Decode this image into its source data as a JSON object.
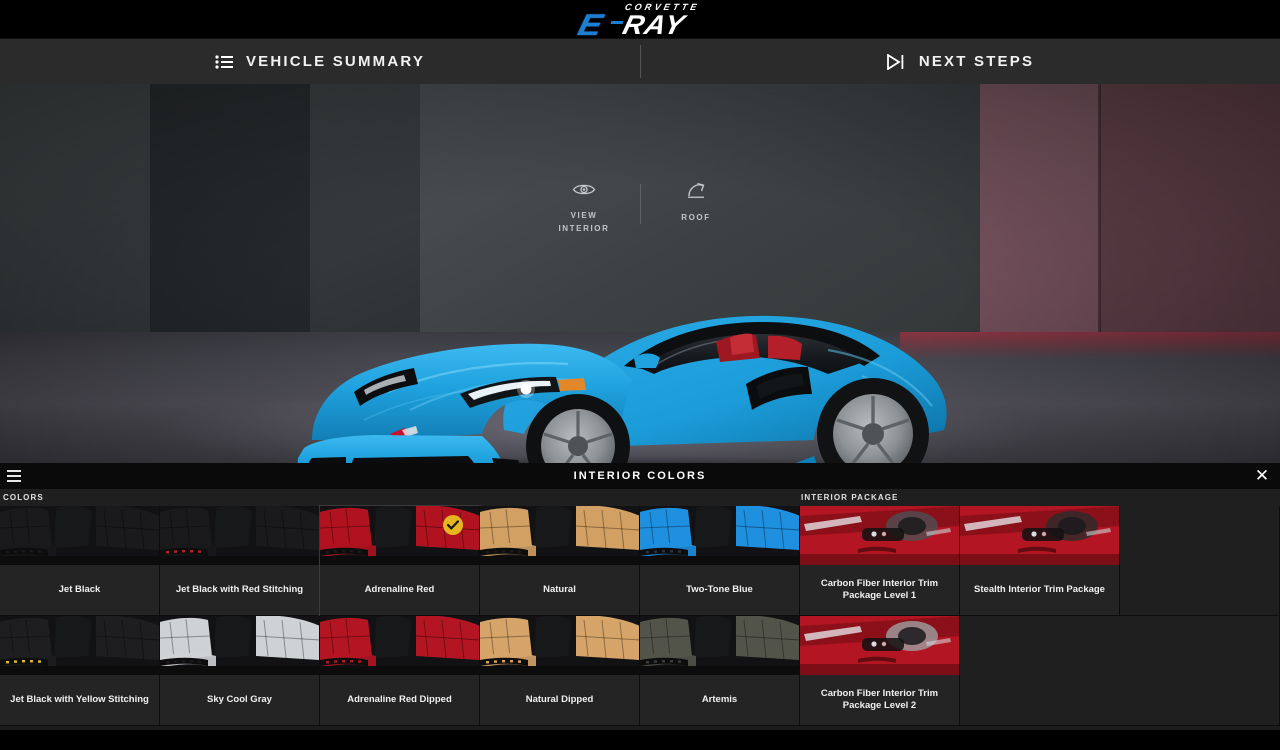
{
  "brand": {
    "name_top": "CORVETTE",
    "name_main": "RAY",
    "mark": "E"
  },
  "top_nav": [
    {
      "id": "vehicle-summary",
      "label": "VEHICLE SUMMARY",
      "icon": "list-icon"
    },
    {
      "id": "next-steps",
      "label": "NEXT STEPS",
      "icon": "play-next-icon"
    }
  ],
  "stage": {
    "controls": [
      {
        "id": "view-interior",
        "line1": "VIEW",
        "line2": "INTERIOR",
        "icon": "eye-icon"
      },
      {
        "id": "roof",
        "line1": "ROOF",
        "line2": "",
        "icon": "roof-arrow-icon"
      }
    ],
    "vehicle": {
      "body_color": "#1fa2de",
      "interior_color": "#b3202a",
      "wheel_color": "#8e9296"
    }
  },
  "panel": {
    "title": "INTERIOR COLORS",
    "menu_icon": "hamburger-icon",
    "close_icon": "close-icon",
    "sections": [
      {
        "id": "colors",
        "label": "COLORS"
      },
      {
        "id": "interior-package",
        "label": "INTERIOR PACKAGE"
      }
    ],
    "selected_swatch": "Adrenaline Red",
    "check_color": "#e7b51f",
    "rows": [
      [
        {
          "id": "jet-black",
          "label": "Jet Black",
          "group": "colors",
          "swatch": "#1a1a1c",
          "accent": "#1a1a1c",
          "selected": false
        },
        {
          "id": "jet-black-red-stitching",
          "label": "Jet Black with Red Stitching",
          "group": "colors",
          "swatch": "#1a1a1c",
          "accent": "#b3202a",
          "selected": false
        },
        {
          "id": "adrenaline-red",
          "label": "Adrenaline Red",
          "group": "colors",
          "swatch": "#b0121f",
          "accent": "#1a1a1c",
          "selected": true
        },
        {
          "id": "natural",
          "label": "Natural",
          "group": "colors",
          "swatch": "#d2a063",
          "accent": "#1a1a1c",
          "selected": false
        },
        {
          "id": "two-tone-blue",
          "label": "Two-Tone Blue",
          "group": "colors",
          "swatch": "#1f8fe0",
          "accent": "#2b3140",
          "selected": false
        },
        {
          "id": "carbon-fiber-level-1",
          "label": "Carbon Fiber Interior Trim Package Level 1",
          "group": "package",
          "swatch": "#b41522",
          "accent": "#4c4f52",
          "selected": false
        },
        {
          "id": "stealth-trim",
          "label": "Stealth Interior Trim Package",
          "group": "package",
          "swatch": "#b41522",
          "accent": "#2a2a2c",
          "selected": false
        }
      ],
      [
        {
          "id": "jet-black-yellow-stitching",
          "label": "Jet Black with Yellow Stitching",
          "group": "colors",
          "swatch": "#1e1e20",
          "accent": "#d8b93a",
          "selected": false
        },
        {
          "id": "sky-cool-gray",
          "label": "Sky Cool Gray",
          "group": "colors",
          "swatch": "#cfd2d4",
          "accent": "#1a1a1c",
          "selected": false
        },
        {
          "id": "adrenaline-red-dipped",
          "label": "Adrenaline Red Dipped",
          "group": "colors",
          "swatch": "#b41522",
          "accent": "#b41522",
          "selected": false
        },
        {
          "id": "natural-dipped",
          "label": "Natural Dipped",
          "group": "colors",
          "swatch": "#d6a468",
          "accent": "#d6a468",
          "selected": false
        },
        {
          "id": "artemis",
          "label": "Artemis",
          "group": "colors",
          "swatch": "#52544a",
          "accent": "#3b3d36",
          "selected": false
        },
        {
          "id": "carbon-fiber-level-2",
          "label": "Carbon Fiber Interior Trim Package Level 2",
          "group": "package",
          "swatch": "#b41522",
          "accent": "#9da0a3",
          "selected": false
        }
      ]
    ]
  }
}
